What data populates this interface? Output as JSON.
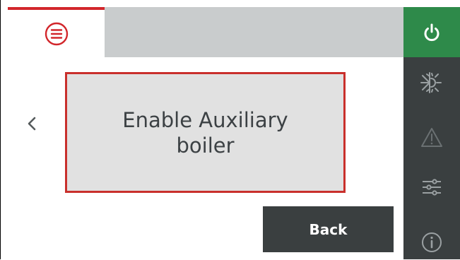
{
  "header": {
    "menu_icon": "hamburger-menu-icon"
  },
  "main": {
    "message": "Enable Auxiliary boiler",
    "back_button_label": "Back",
    "prev_icon": "chevron-left-icon"
  },
  "sidebar": {
    "items": [
      {
        "icon": "power-icon"
      },
      {
        "icon": "heat-cool-mode-icon"
      },
      {
        "icon": "warning-icon"
      },
      {
        "icon": "settings-sliders-icon"
      },
      {
        "icon": "info-icon"
      }
    ]
  },
  "colors": {
    "accent_red": "#d2262b",
    "power_green": "#2e8a4a",
    "sidebar_dark": "#3a3f40",
    "top_bar_gray": "#c9cccd",
    "message_bg": "#e1e1e1"
  }
}
